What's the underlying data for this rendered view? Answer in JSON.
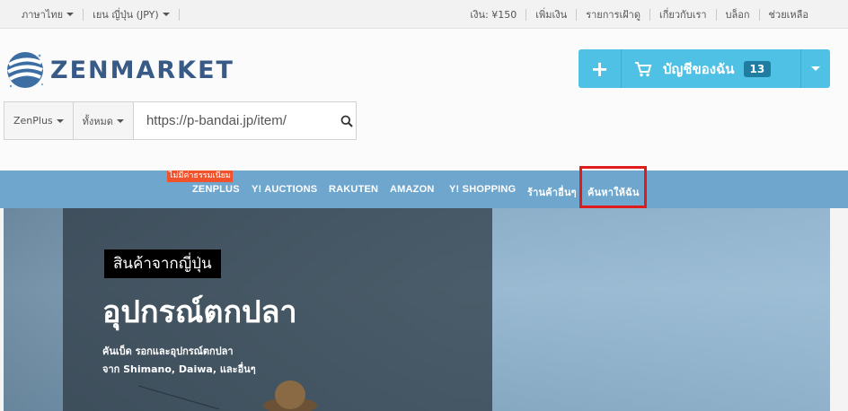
{
  "topbar": {
    "language": "ภาษาไทย",
    "currency": "เยน ญี่ปุ่น (JPY)",
    "balance": "เงิน: ¥150",
    "add_funds": "เพิ่มเงิน",
    "watchlist": "รายการเฝ้าดู",
    "about": "เกี่ยวกับเรา",
    "blog": "บล็อก",
    "help": "ช่วยเหลือ"
  },
  "logo": {
    "text": "ZENMARKET"
  },
  "cart": {
    "plus": "+",
    "label": "บัญชีของฉัน",
    "count": "13"
  },
  "search": {
    "category1": "ZenPlus",
    "category2": "ทั้งหมด",
    "value": "https://p-bandai.jp/item/"
  },
  "nav": {
    "badge": "ไม่มีค่าธรรมเนียม",
    "items": [
      "ZENPLUS",
      "Y! AUCTIONS",
      "RAKUTEN",
      "AMAZON",
      "Y! SHOPPING",
      "ร้านค้าอื่นๆ",
      "ค้นหาให้ฉัน"
    ]
  },
  "hero": {
    "tag": "สินค้าจากญี่ปุ่น",
    "title": "อุปกรณ์ตกปลา",
    "desc_line1": "คันเบ็ด รอกและอุปกรณ์ตกปลา",
    "desc_line2": "จาก Shimano, Daiwa, และอื่นๆ"
  },
  "colors": {
    "brand": "#385a86",
    "cart": "#4ec1e4",
    "nav": "#6fa6cd",
    "badge": "#f0532c",
    "highlight": "#e01b1b"
  }
}
